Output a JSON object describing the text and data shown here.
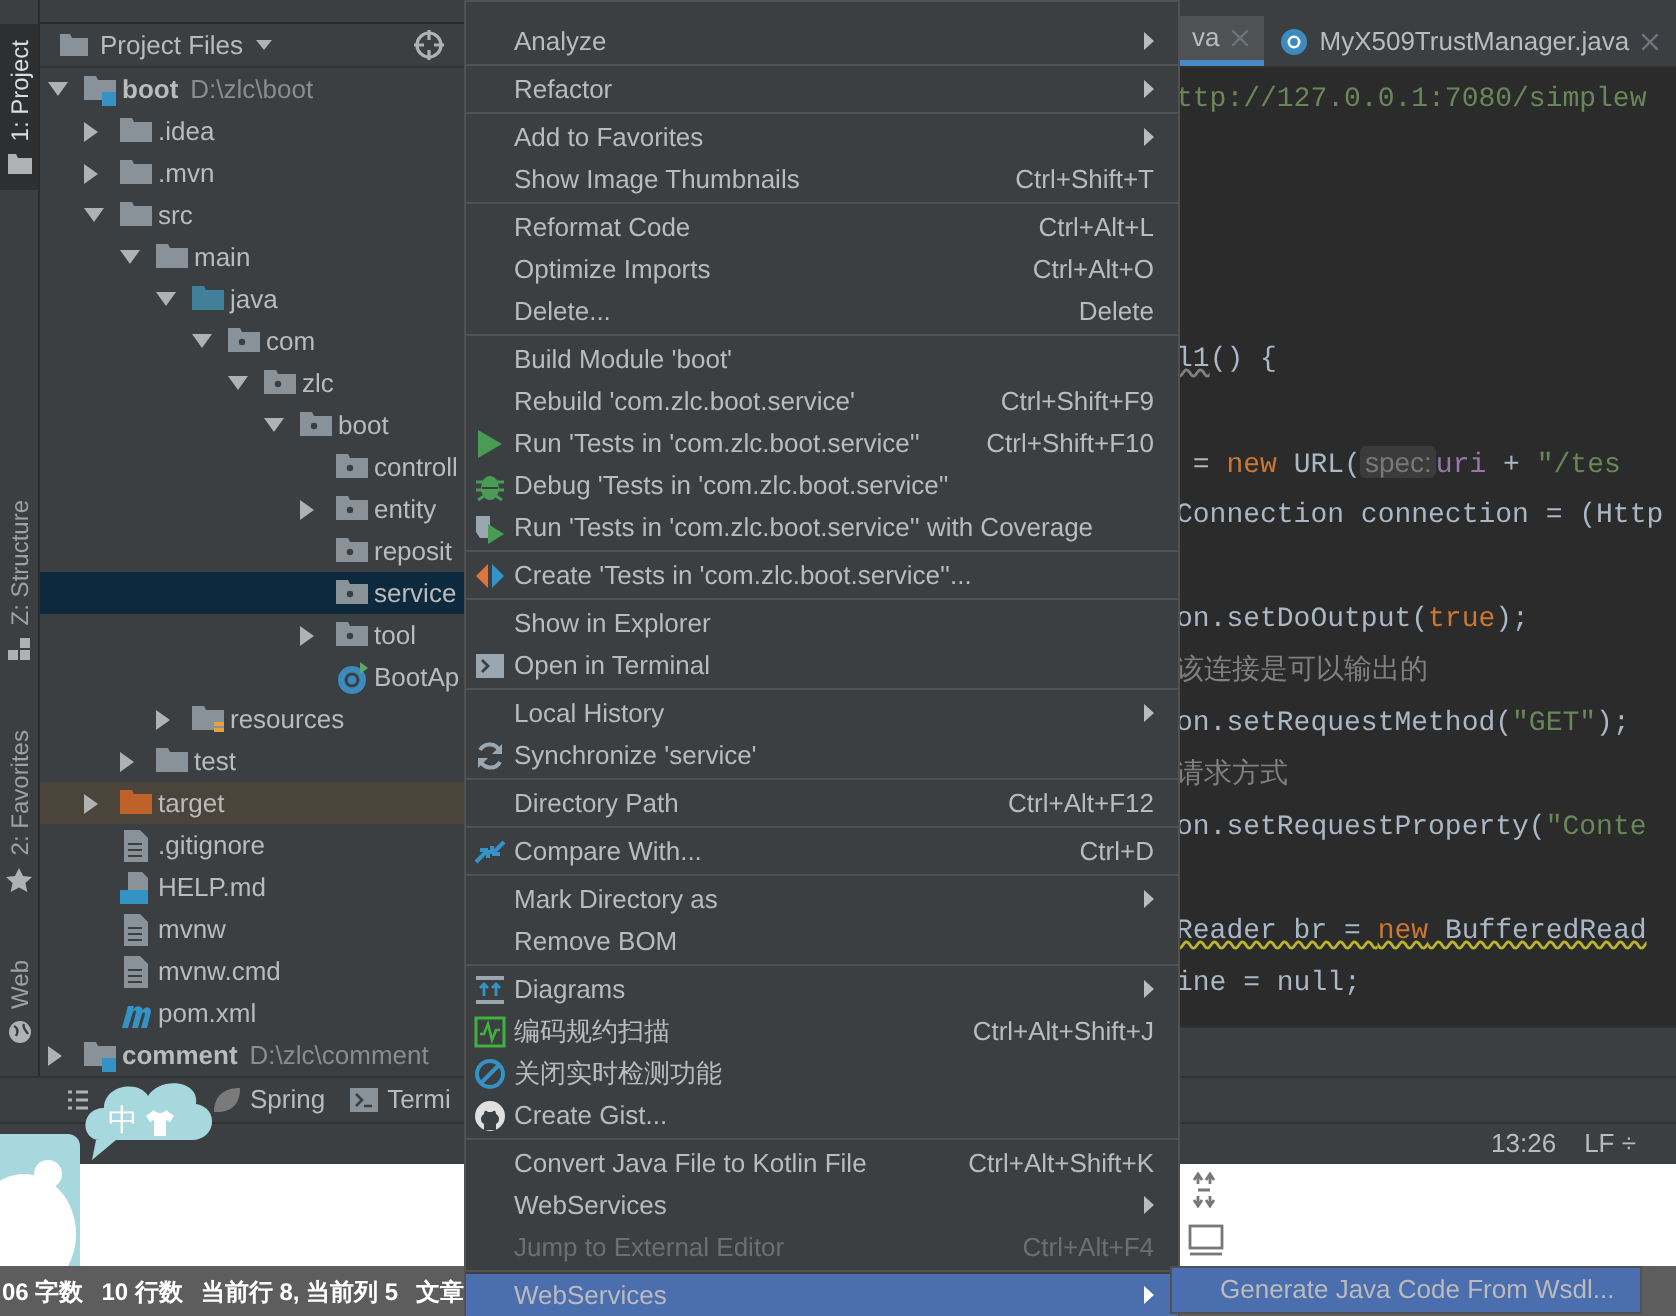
{
  "stripe": {
    "tabs": [
      {
        "label": "1: Project",
        "selected": true,
        "kind": "project"
      },
      {
        "label": "Z: Structure",
        "selected": false,
        "kind": "structure"
      },
      {
        "label": "2: Favorites",
        "selected": false,
        "kind": "favorites"
      },
      {
        "label": "Web",
        "selected": false,
        "kind": "web"
      }
    ]
  },
  "project": {
    "title": "Project Files",
    "tree": [
      {
        "label": "boot",
        "kind": "module",
        "path": "D:\\zlc\\boot",
        "expanded": true,
        "selected": false,
        "children": [
          {
            "label": ".idea",
            "kind": "folder",
            "expanded": false,
            "selected": false
          },
          {
            "label": ".mvn",
            "kind": "folder",
            "expanded": false,
            "selected": false
          },
          {
            "label": "src",
            "kind": "folder",
            "expanded": true,
            "selected": false,
            "children": [
              {
                "label": "main",
                "kind": "folder",
                "expanded": true,
                "selected": false,
                "children": [
                  {
                    "label": "java",
                    "kind": "source",
                    "expanded": true,
                    "selected": false,
                    "children": [
                      {
                        "label": "com",
                        "kind": "package",
                        "expanded": true,
                        "selected": false,
                        "children": [
                          {
                            "label": "zlc",
                            "kind": "package",
                            "expanded": true,
                            "selected": false,
                            "children": [
                              {
                                "label": "boot",
                                "kind": "package",
                                "expanded": true,
                                "selected": false,
                                "children": [
                                  {
                                    "label": "controll",
                                    "kind": "package",
                                    "selected": false
                                  },
                                  {
                                    "label": "entity",
                                    "kind": "package",
                                    "expanded": false,
                                    "selected": false
                                  },
                                  {
                                    "label": "reposit",
                                    "kind": "package",
                                    "selected": false
                                  },
                                  {
                                    "label": "service",
                                    "kind": "package",
                                    "selected": true
                                  },
                                  {
                                    "label": "tool",
                                    "kind": "package",
                                    "expanded": false,
                                    "selected": false
                                  },
                                  {
                                    "label": "BootAp",
                                    "kind": "class",
                                    "selected": false
                                  }
                                ]
                              }
                            ]
                          }
                        ]
                      }
                    ]
                  },
                  {
                    "label": "resources",
                    "kind": "resources",
                    "expanded": false,
                    "selected": false
                  }
                ]
              },
              {
                "label": "test",
                "kind": "folder",
                "expanded": false,
                "selected": false
              }
            ]
          },
          {
            "label": "target",
            "kind": "excluded",
            "expanded": false,
            "selected": false
          },
          {
            "label": ".gitignore",
            "kind": "file",
            "selected": false
          },
          {
            "label": "HELP.md",
            "kind": "markdown",
            "selected": false
          },
          {
            "label": "mvnw",
            "kind": "file",
            "selected": false
          },
          {
            "label": "mvnw.cmd",
            "kind": "file",
            "selected": false
          },
          {
            "label": "pom.xml",
            "kind": "maven",
            "selected": false
          }
        ]
      },
      {
        "label": "comment",
        "kind": "module",
        "path": "D:\\zlc\\comment",
        "expanded": false,
        "selected": false
      }
    ]
  },
  "editor": {
    "tabs": [
      {
        "label": "va",
        "selected": true
      },
      {
        "label": "MyX509TrustManager.java",
        "selected": false
      }
    ],
    "lines": [
      {
        "kind": "code",
        "segments": [
          {
            "kind": "string",
            "text": "ttp://127.0.0.1:7080/simplew"
          }
        ]
      },
      {
        "kind": "blank"
      },
      {
        "kind": "blank"
      },
      {
        "kind": "blank"
      },
      {
        "kind": "blank"
      },
      {
        "kind": "code",
        "segments": [
          {
            "kind": "text",
            "text": "l1",
            "underlined": true
          },
          {
            "kind": "text",
            "text": "() {"
          }
        ]
      },
      {
        "kind": "blank"
      },
      {
        "kind": "code",
        "segments": [
          {
            "kind": "text",
            "text": " = "
          },
          {
            "kind": "keyword",
            "text": "new"
          },
          {
            "kind": "text",
            "text": " URL("
          },
          {
            "kind": "hint",
            "text": "spec:"
          },
          {
            "kind": "param",
            "text": "uri"
          },
          {
            "kind": "text",
            "text": " + "
          },
          {
            "kind": "string",
            "text": "\"/tes"
          }
        ]
      },
      {
        "kind": "code",
        "segments": [
          {
            "kind": "text",
            "text": "Connection connection = (Http"
          }
        ]
      },
      {
        "kind": "blank"
      },
      {
        "kind": "code",
        "segments": [
          {
            "kind": "text",
            "text": "on.setDoOutput("
          },
          {
            "kind": "keyword",
            "text": "true"
          },
          {
            "kind": "text",
            "text": ");"
          }
        ]
      },
      {
        "kind": "code",
        "segments": [
          {
            "kind": "comment",
            "text": "该连接是可以输出的"
          }
        ]
      },
      {
        "kind": "code",
        "segments": [
          {
            "kind": "text",
            "text": "on.setRequestMethod("
          },
          {
            "kind": "string",
            "text": "\"GET\""
          },
          {
            "kind": "text",
            "text": ");"
          }
        ]
      },
      {
        "kind": "code",
        "segments": [
          {
            "kind": "comment",
            "text": "请求方式"
          }
        ]
      },
      {
        "kind": "code",
        "segments": [
          {
            "kind": "text",
            "text": "on.setRequestProperty("
          },
          {
            "kind": "string",
            "text": "\"Conte"
          }
        ]
      },
      {
        "kind": "blank"
      },
      {
        "kind": "code",
        "warning": true,
        "segments": [
          {
            "kind": "text",
            "text": "Reader br = "
          },
          {
            "kind": "keyword",
            "text": "new"
          },
          {
            "kind": "text",
            "text": " BufferedRead"
          }
        ]
      },
      {
        "kind": "code",
        "segments": [
          {
            "kind": "text",
            "text": "ine = null;"
          }
        ]
      }
    ]
  },
  "tool_bar": {
    "items": [
      {
        "label": "Spring",
        "kind": "spring"
      },
      {
        "label": "Termi",
        "kind": "terminal"
      }
    ]
  },
  "ime": {
    "label": "中"
  },
  "status": {
    "position": "13:26",
    "line_separator": "LF ÷"
  },
  "bottom_status": [
    "06 字数",
    "10 行数",
    "当前行 8, 当前列 5",
    "文章"
  ],
  "menu": {
    "items": [
      {
        "kind": "item",
        "label": "Analyze",
        "submenu": true,
        "disabled": false,
        "selected": false
      },
      {
        "kind": "separator"
      },
      {
        "kind": "item",
        "label": "Refactor",
        "submenu": true,
        "disabled": false,
        "selected": false
      },
      {
        "kind": "separator"
      },
      {
        "kind": "item",
        "label": "Add to Favorites",
        "submenu": true,
        "disabled": false,
        "selected": false
      },
      {
        "kind": "item",
        "label": "Show Image Thumbnails",
        "shortcut": "Ctrl+Shift+T",
        "submenu": false,
        "disabled": false,
        "selected": false
      },
      {
        "kind": "separator"
      },
      {
        "kind": "item",
        "label": "Reformat Code",
        "shortcut": "Ctrl+Alt+L",
        "submenu": false,
        "disabled": false,
        "selected": false
      },
      {
        "kind": "item",
        "label": "Optimize Imports",
        "shortcut": "Ctrl+Alt+O",
        "submenu": false,
        "disabled": false,
        "selected": false
      },
      {
        "kind": "item",
        "label": "Delete...",
        "shortcut": "Delete",
        "submenu": false,
        "disabled": false,
        "selected": false
      },
      {
        "kind": "separator"
      },
      {
        "kind": "item",
        "label": "Build Module 'boot'",
        "submenu": false,
        "disabled": false,
        "selected": false
      },
      {
        "kind": "item",
        "label": "Rebuild 'com.zlc.boot.service'",
        "shortcut": "Ctrl+Shift+F9",
        "submenu": false,
        "disabled": false,
        "selected": false
      },
      {
        "kind": "run",
        "label": "Run 'Tests in 'com.zlc.boot.service''",
        "shortcut": "Ctrl+Shift+F10",
        "submenu": false,
        "disabled": false,
        "selected": false
      },
      {
        "kind": "debug",
        "label": "Debug 'Tests in 'com.zlc.boot.service''",
        "submenu": false,
        "disabled": false,
        "selected": false
      },
      {
        "kind": "coverage",
        "label": "Run 'Tests in 'com.zlc.boot.service'' with Coverage",
        "submenu": false,
        "disabled": false,
        "selected": false
      },
      {
        "kind": "separator"
      },
      {
        "kind": "create",
        "label": "Create 'Tests in 'com.zlc.boot.service''...",
        "submenu": false,
        "disabled": false,
        "selected": false
      },
      {
        "kind": "separator"
      },
      {
        "kind": "item",
        "label": "Show in Explorer",
        "submenu": false,
        "disabled": false,
        "selected": false
      },
      {
        "kind": "terminal",
        "label": "Open in Terminal",
        "submenu": false,
        "disabled": false,
        "selected": false
      },
      {
        "kind": "separator"
      },
      {
        "kind": "item",
        "label": "Local History",
        "submenu": true,
        "disabled": false,
        "selected": false
      },
      {
        "kind": "sync",
        "label": "Synchronize 'service'",
        "submenu": false,
        "disabled": false,
        "selected": false
      },
      {
        "kind": "separator"
      },
      {
        "kind": "item",
        "label": "Directory Path",
        "shortcut": "Ctrl+Alt+F12",
        "submenu": false,
        "disabled": false,
        "selected": false
      },
      {
        "kind": "separator"
      },
      {
        "kind": "compare",
        "label": "Compare With...",
        "shortcut": "Ctrl+D",
        "submenu": false,
        "disabled": false,
        "selected": false
      },
      {
        "kind": "separator"
      },
      {
        "kind": "item",
        "label": "Mark Directory as",
        "submenu": true,
        "disabled": false,
        "selected": false
      },
      {
        "kind": "item",
        "label": "Remove BOM",
        "submenu": false,
        "disabled": false,
        "selected": false
      },
      {
        "kind": "separator"
      },
      {
        "kind": "diagram",
        "label": "Diagrams",
        "submenu": true,
        "disabled": false,
        "selected": false
      },
      {
        "kind": "scan",
        "label": "编码规约扫描",
        "shortcut": "Ctrl+Alt+Shift+J",
        "submenu": false,
        "disabled": false,
        "selected": false
      },
      {
        "kind": "block",
        "label": "关闭实时检测功能",
        "submenu": false,
        "disabled": false,
        "selected": false
      },
      {
        "kind": "github",
        "label": "Create Gist...",
        "submenu": false,
        "disabled": false,
        "selected": false
      },
      {
        "kind": "separator"
      },
      {
        "kind": "item",
        "label": "Convert Java File to Kotlin File",
        "shortcut": "Ctrl+Alt+Shift+K",
        "submenu": false,
        "disabled": false,
        "selected": false
      },
      {
        "kind": "item",
        "label": "WebServices",
        "submenu": true,
        "disabled": false,
        "selected": false
      },
      {
        "kind": "item",
        "label": "Jump to External Editor",
        "shortcut": "Ctrl+Alt+F4",
        "submenu": false,
        "disabled": true,
        "selected": false
      },
      {
        "kind": "separator"
      },
      {
        "kind": "item",
        "label": "WebServices",
        "submenu": true,
        "disabled": false,
        "selected": true
      }
    ]
  },
  "submenu": {
    "items": [
      {
        "label": "Generate Java Code From Wsdl...",
        "selected": true
      }
    ]
  }
}
